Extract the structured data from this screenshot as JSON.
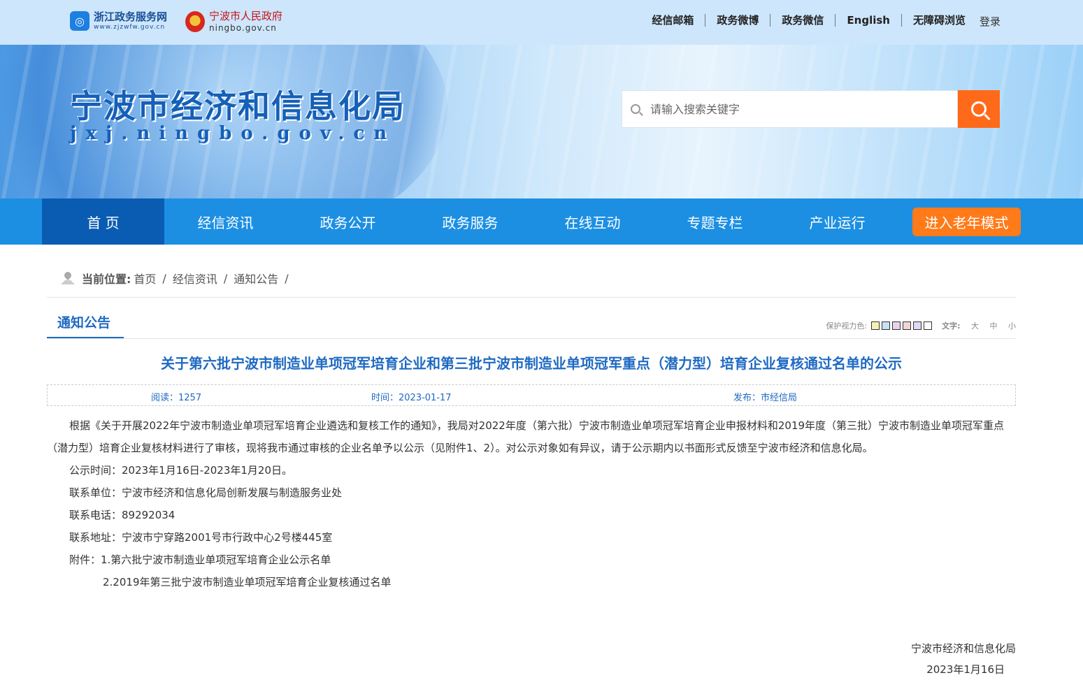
{
  "topbar": {
    "zj_logo_title": "浙江政务服务网",
    "zj_logo_url": "www.zjzwfw.gov.cn",
    "nb_logo_title": "宁波市人民政府",
    "nb_logo_url": "ningbo.gov.cn",
    "links": [
      "经信邮箱",
      "政务微博",
      "政务微信",
      "English",
      "无障碍浏览"
    ],
    "login": "登录"
  },
  "banner": {
    "title": "宁波市经济和信息化局",
    "url": "jxj.ningbo.gov.cn",
    "search_placeholder": "请输入搜索关键字"
  },
  "nav": {
    "items": [
      "首 页",
      "经信资讯",
      "政务公开",
      "政务服务",
      "在线互动",
      "专题专栏",
      "产业运行"
    ],
    "elder_mode": "进入老年模式"
  },
  "breadcrumb": {
    "label": "当前位置:",
    "items": [
      "首页",
      "经信资讯",
      "通知公告"
    ],
    "sep": "/"
  },
  "section": {
    "tab": "通知公告",
    "protect_label": "保护视力色:",
    "swatch_colors": [
      "#f6f3b1",
      "#c5e3f3",
      "#e8d3e7",
      "#f1d5d5",
      "#e4d6f5",
      "#ffffff"
    ],
    "font_label": "文字:",
    "font_sizes": [
      "大",
      "中",
      "小"
    ]
  },
  "article": {
    "title": "关于第六批宁波市制造业单项冠军培育企业和第三批宁波市制造业单项冠军重点（潜力型）培育企业复核通过名单的公示",
    "reads": "阅读：1257",
    "time": "时间：2023-01-17",
    "publisher": "发布：市经信局",
    "para1": "根据《关于开展2022年宁波市制造业单项冠军培育企业遴选和复核工作的通知》，我局对2022年度（第六批）宁波市制造业单项冠军培育企业申报材料和2019年度（第三批）宁波市制造业单项冠军重点（潜力型）培育企业复核材料进行了审核，现将我市通过审核的企业名单予以公示（见附件1、2）。对公示对象如有异议，请于公示期内以书面形式反馈至宁波市经济和信息化局。",
    "period": "公示时间：2023年1月16日-2023年1月20日。",
    "unit": "联系单位：宁波市经济和信息化局创新发展与制造服务业处",
    "phone": "联系电话：89292034",
    "address": "联系地址：宁波市宁穿路2001号市行政中心2号楼445室",
    "attach1": "附件：1.第六批宁波市制造业单项冠军培育企业公示名单",
    "attach2": "2.2019年第三批宁波市制造业单项冠军培育企业复核通过名单",
    "sign_org": "宁波市经济和信息化局",
    "sign_date": "2023年1月16日"
  }
}
